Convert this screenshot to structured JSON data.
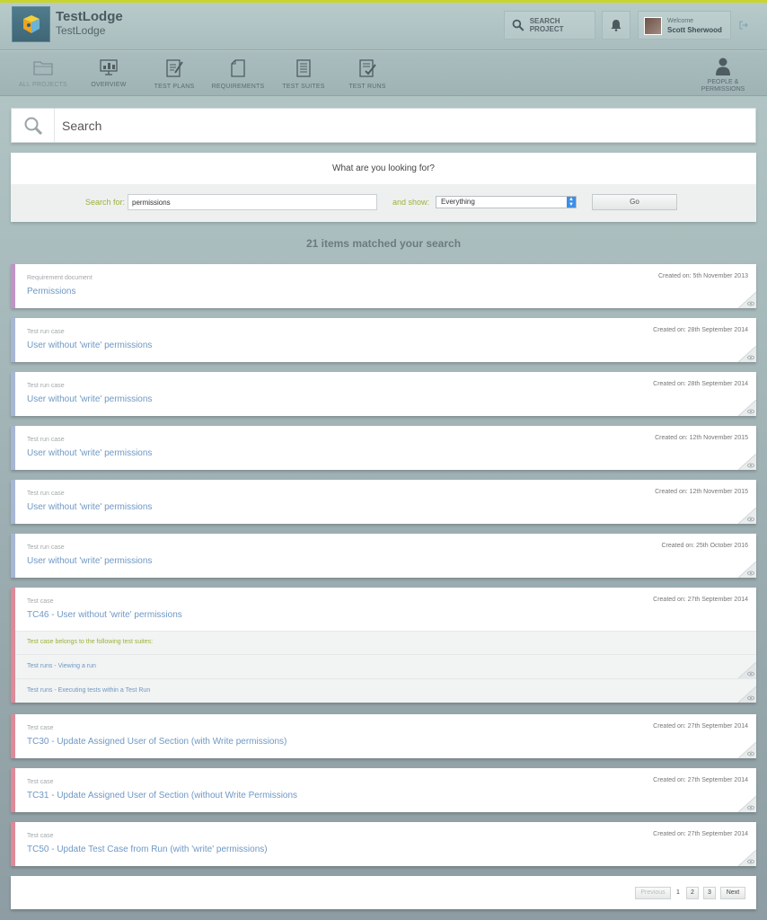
{
  "app": {
    "title": "TestLodge",
    "subtitle": "TestLodge"
  },
  "header": {
    "search_project_label": "SEARCH PROJECT",
    "welcome_label": "Welcome",
    "user_name": "Scott Sherwood"
  },
  "nav": {
    "items": [
      {
        "label": "ALL PROJECTS",
        "icon": "folder-icon"
      },
      {
        "label": "OVERVIEW",
        "icon": "monitor-icon"
      },
      {
        "label": "TEST PLANS",
        "icon": "edit-document-icon"
      },
      {
        "label": "REQUIREMENTS",
        "icon": "document-icon"
      },
      {
        "label": "TEST SUITES",
        "icon": "list-document-icon"
      },
      {
        "label": "TEST RUNS",
        "icon": "checklist-icon"
      }
    ],
    "people_line1": "PEOPLE &",
    "people_line2": "PERMISSIONS"
  },
  "search": {
    "title": "Search",
    "question": "What are you looking for?",
    "search_for_label": "Search for:",
    "query": "permissions",
    "and_show_label": "and show:",
    "show_selected": "Everything",
    "go_label": "Go",
    "results_count": "21 items matched your search"
  },
  "results": [
    {
      "type": "Requirement document",
      "title": "Permissions",
      "date": "Created on: 5th November 2013"
    },
    {
      "type": "Test run case",
      "title": "User without 'write' permissions",
      "date": "Created on: 28th September 2014"
    },
    {
      "type": "Test run case",
      "title": "User without 'write' permissions",
      "date": "Created on: 28th September 2014"
    },
    {
      "type": "Test run case",
      "title": "User without 'write' permissions",
      "date": "Created on: 12th November 2015"
    },
    {
      "type": "Test run case",
      "title": "User without 'write' permissions",
      "date": "Created on: 12th November 2015"
    },
    {
      "type": "Test run case",
      "title": "User without 'write' permissions",
      "date": "Created on: 25th October 2016"
    },
    {
      "type": "Test case",
      "title": "TC46 - User without 'write' permissions",
      "date": "Created on: 27th September 2014",
      "suites_heading": "Test case belongs to the following test suites:",
      "suites": [
        "Test runs - Viewing a run",
        "Test runs - Executing tests within a Test Run"
      ]
    },
    {
      "type": "Test case",
      "title": "TC30 - Update Assigned User of Section (with Write permissions)",
      "date": "Created on: 27th September 2014"
    },
    {
      "type": "Test case",
      "title": "TC31 - Update Assigned User of Section (without Write Permissions",
      "date": "Created on: 27th September 2014"
    },
    {
      "type": "Test case",
      "title": "TC50 - Update Test Case from Run (with 'write' permissions)",
      "date": "Created on: 27th September 2014"
    }
  ],
  "pagination": {
    "previous": "Previous",
    "current": "1",
    "pages": [
      "2",
      "3"
    ],
    "next": "Next"
  }
}
